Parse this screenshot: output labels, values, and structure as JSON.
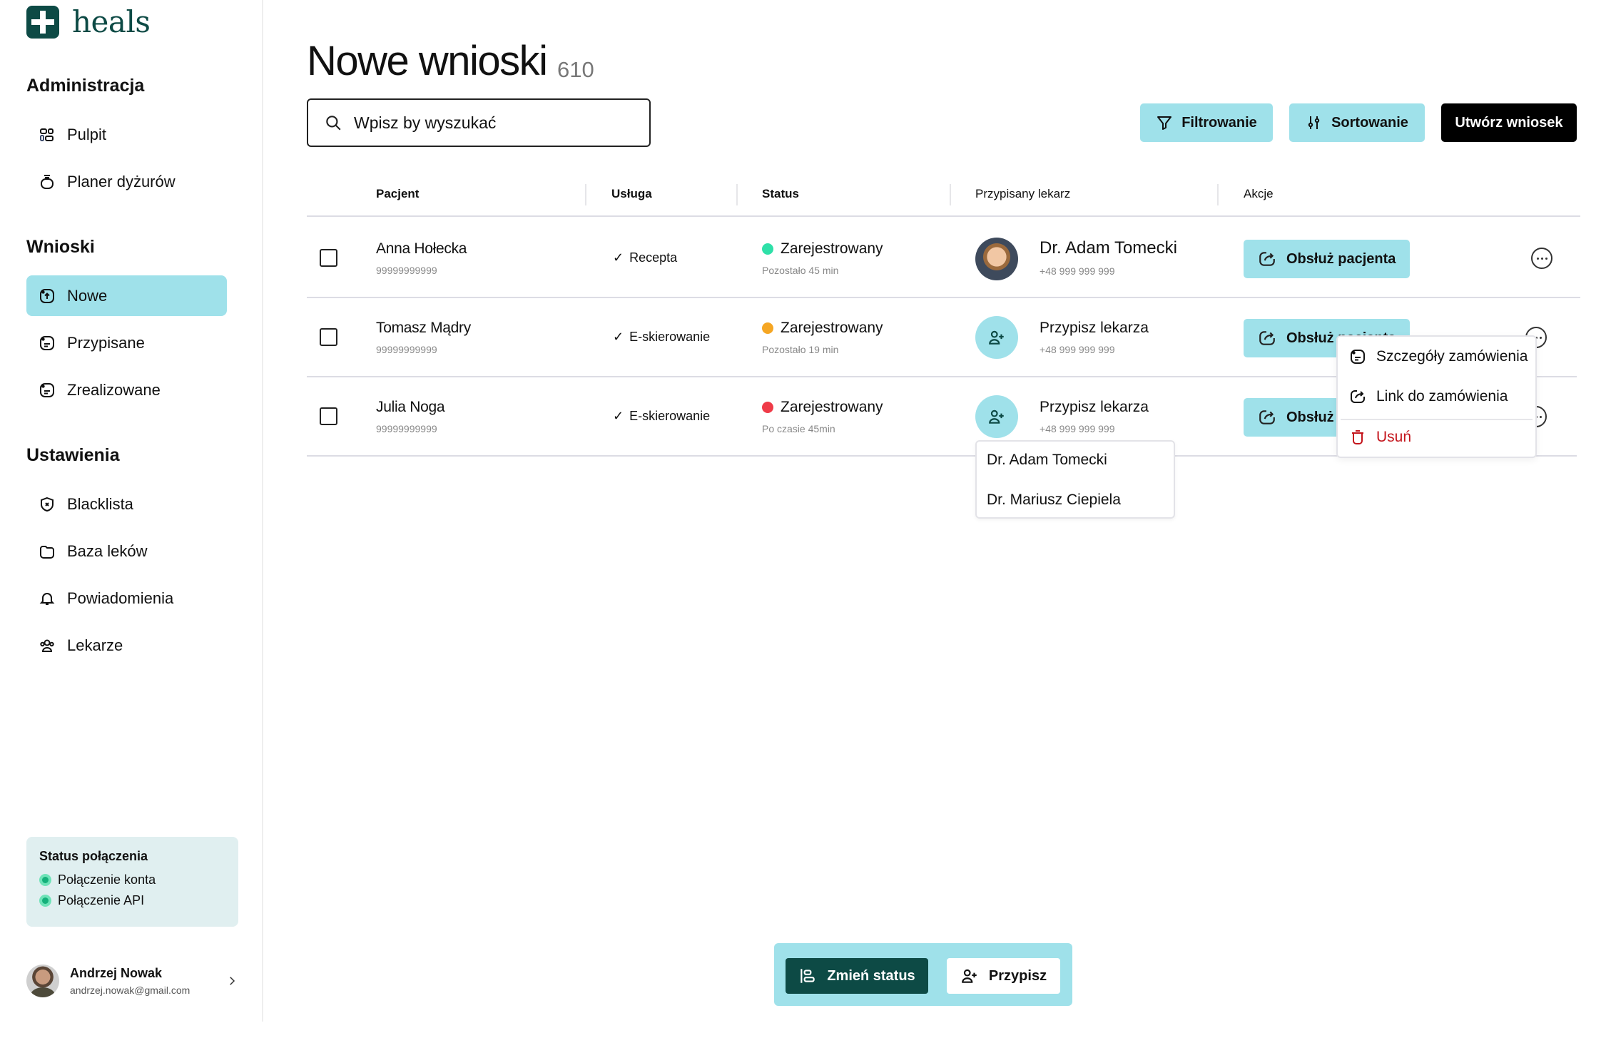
{
  "app": {
    "brand": "heals",
    "brand_color": "#0d4a45",
    "accent_color": "#9fe1ea"
  },
  "sidebar": {
    "sections": [
      {
        "heading": "Administracja",
        "items": [
          {
            "label": "Pulpit",
            "icon": "dashboard-icon"
          },
          {
            "label": "Planer dyżurów",
            "icon": "planner-icon"
          }
        ]
      },
      {
        "heading": "Wnioski",
        "items": [
          {
            "label": "Nowe",
            "icon": "new-request-icon",
            "active": true
          },
          {
            "label": "Przypisane",
            "icon": "note-icon"
          },
          {
            "label": "Zrealizowane",
            "icon": "note-icon"
          }
        ]
      },
      {
        "heading": "Ustawienia",
        "items": [
          {
            "label": "Blacklista",
            "icon": "shield-x-icon"
          },
          {
            "label": "Baza leków",
            "icon": "folder-icon"
          },
          {
            "label": "Powiadomienia",
            "icon": "bell-icon"
          },
          {
            "label": "Lekarze",
            "icon": "users-icon"
          }
        ]
      }
    ],
    "connection_status": {
      "title": "Status połączenia",
      "items": [
        {
          "label": "Połączenie konta",
          "color": "#14b07a"
        },
        {
          "label": "Połączenie API",
          "color": "#14b07a"
        }
      ]
    },
    "user": {
      "name": "Andrzej Nowak",
      "email": "andrzej.nowak@gmail.com"
    }
  },
  "main": {
    "title": "Nowe wnioski",
    "count": "610",
    "search": {
      "placeholder": "Wpisz by wyszukać",
      "value": ""
    },
    "toolbar": {
      "filter_label": "Filtrowanie",
      "sort_label": "Sortowanie",
      "create_label": "Utwórz wniosek"
    },
    "table": {
      "columns": [
        "Pacjent",
        "Usługa",
        "Status",
        "Przypisany lekarz",
        "Akcje"
      ],
      "rows": [
        {
          "patient": "Anna Hołecka",
          "patient_id": "99999999999",
          "service": "Recepta",
          "status": "Zarejestrowany",
          "status_color": "#2ee0a8",
          "status_note": "Pozostało 45 min",
          "doctor": "Dr. Adam Tomecki",
          "doctor_phone": "+48 999 999 999",
          "doctor_assigned": true,
          "action": "Obsłuż pacjenta"
        },
        {
          "patient": "Tomasz Mądry",
          "patient_id": "99999999999",
          "service": "E-skierowanie",
          "status": "Zarejestrowany",
          "status_color": "#f5a623",
          "status_note": "Pozostało 19 min",
          "doctor": "Przypisz lekarza",
          "doctor_phone": "+48 999 999 999",
          "doctor_assigned": false,
          "action": "Obsłuż pacjenta"
        },
        {
          "patient": "Julia Noga",
          "patient_id": "99999999999",
          "service": "E-skierowanie",
          "status": "Zarejestrowany",
          "status_color": "#ef3b48",
          "status_note": "Po czasie 45min",
          "doctor": "Przypisz lekarza",
          "doctor_phone": "+48 999 999 999",
          "doctor_assigned": false,
          "action": "Obsłuż pacjenta"
        }
      ]
    },
    "doctor_dropdown": {
      "options": [
        "Dr. Adam Tomecki",
        "Dr. Mariusz  Ciepiela"
      ]
    },
    "context_menu": {
      "items": [
        {
          "label": "Szczegóły zamówienia",
          "icon": "note-icon"
        },
        {
          "label": "Link do zamówienia",
          "icon": "share-icon"
        },
        {
          "label": "Usuń",
          "icon": "trash-icon",
          "danger": true,
          "color": "#c4151c"
        }
      ]
    },
    "bulk_actions": {
      "change_status_label": "Zmień status",
      "assign_label": "Przypisz"
    }
  }
}
